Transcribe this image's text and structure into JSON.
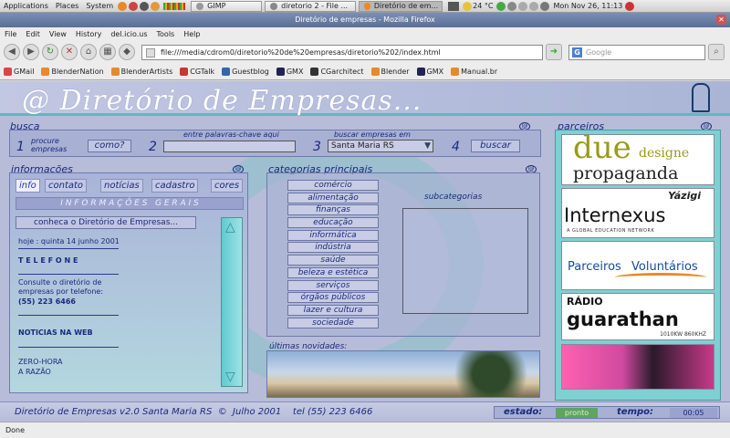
{
  "panel": {
    "menus": [
      "Applications",
      "Places",
      "System"
    ],
    "tasks": [
      {
        "label": "GIMP"
      },
      {
        "label": "diretorio 2 - File ..."
      },
      {
        "label": "Diretório de em..."
      }
    ],
    "weather": "24 °C",
    "clock": "Mon Nov 26, 11:13"
  },
  "browser": {
    "title": "Diretório de empresas - Mozilla Firefox",
    "menu": [
      "File",
      "Edit",
      "View",
      "History",
      "del.icio.us",
      "Tools",
      "Help"
    ],
    "url": "file:///media/cdrom0/diretorio%20de%20empresas/diretorio%202/index.html",
    "search_placeholder": "Google",
    "bookmarks": [
      {
        "label": "GMail",
        "color": "#d44"
      },
      {
        "label": "BlenderNation",
        "color": "#e8892a"
      },
      {
        "label": "BlenderArtists",
        "color": "#e8892a"
      },
      {
        "label": "CGTalk",
        "color": "#c33"
      },
      {
        "label": "Guestblog",
        "color": "#36a"
      },
      {
        "label": "GMX",
        "color": "#225"
      },
      {
        "label": "CGarchitect",
        "color": "#333"
      },
      {
        "label": "Blender",
        "color": "#e8892a"
      },
      {
        "label": "GMX",
        "color": "#225"
      },
      {
        "label": "Manual.br",
        "color": "#e8892a"
      }
    ],
    "status": "Done"
  },
  "site": {
    "logo": "@ Diretório de Empresas...",
    "busca": {
      "title": "busca",
      "step1_num": "1",
      "step1_label": "procure empresas",
      "como_button": "como?",
      "step2_num": "2",
      "step2_label": "entre palavras-chave aqui",
      "step3_num": "3",
      "step3_label": "buscar empresas em",
      "location_value": "Santa Maria RS",
      "step4_num": "4",
      "search_button": "buscar"
    },
    "info": {
      "title": "informações",
      "tabs": [
        "info",
        "contato",
        "notícias",
        "cadastro",
        "cores"
      ],
      "heading": "I N F O R M A Ç Õ E S   G E R A I S",
      "link_button": "conheca o Diretório de Empresas...",
      "today": "hoje : quinta 14 junho 2001",
      "telefone_title": "T E L E F O N E",
      "telefone_text": "Consulte o diretório de empresas por telefone:",
      "telefone_number": "(55) 223 6466",
      "noticias": "NOTICIAS NA WEB",
      "zero_hora": "ZERO-HORA",
      "a_razao": "A RAZÃO"
    },
    "categorias": {
      "title": "categorias principais",
      "items": [
        "comércio",
        "alimentação",
        "finanças",
        "educação",
        "informática",
        "indústria",
        "saúde",
        "beleza e estética",
        "serviços",
        "órgãos públicos",
        "lazer e cultura",
        "sociedade"
      ],
      "sub_title": "subcategorias",
      "news_title": "últimas novidades:"
    },
    "parceiros": {
      "title": "parceiros",
      "due_big": "due",
      "due_small": "designe",
      "due_sub": "propaganda",
      "yazigi": "Yázigi",
      "internexus": "Internexus",
      "internexus_sub": "A GLOBAL EDUCATION NETWORK",
      "parceiros_a": "Parceiros",
      "parceiros_b": "Voluntários",
      "radio": "RÁDIO",
      "guarathan": "guarathan",
      "guarathan_sub": "1010KW 860KHZ"
    },
    "footer": {
      "text": "Diretório de Empresas v2.0 Santa Maria RS  ©  Julho 2001    tel (55) 223 6466",
      "estado_label": "estado:",
      "estado_value": "pronto",
      "tempo_label": "tempo:",
      "tempo_value": "00:05"
    }
  }
}
